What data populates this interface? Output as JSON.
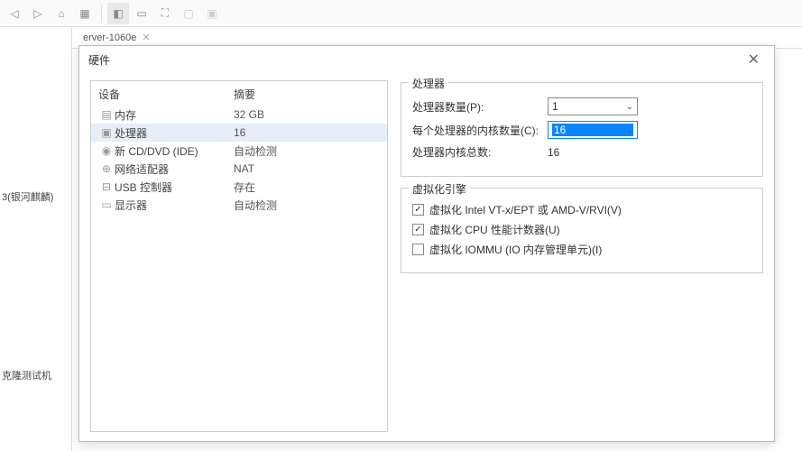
{
  "toolbar": {
    "icons": [
      "back",
      "fwd",
      "home",
      "grid",
      "layout1",
      "layout2",
      "layout3",
      "fit",
      "present"
    ]
  },
  "leftTab": "erver-1060e",
  "sidebarLabels": {
    "l1": "3(银河麒麟)",
    "l2": "克隆测试机"
  },
  "dialog": {
    "title": "硬件"
  },
  "deviceTable": {
    "headers": {
      "device": "设备",
      "summary": "摘要"
    },
    "rows": [
      {
        "icon": "memory",
        "name": "内存",
        "summary": "32 GB",
        "selected": false
      },
      {
        "icon": "cpu",
        "name": "处理器",
        "summary": "16",
        "selected": true
      },
      {
        "icon": "disc",
        "name": "新 CD/DVD (IDE)",
        "summary": "自动检测",
        "selected": false
      },
      {
        "icon": "net",
        "name": "网络适配器",
        "summary": "NAT",
        "selected": false
      },
      {
        "icon": "usb",
        "name": "USB 控制器",
        "summary": "存在",
        "selected": false
      },
      {
        "icon": "display",
        "name": "显示器",
        "summary": "自动检测",
        "selected": false
      }
    ]
  },
  "processorPanel": {
    "legend": "处理器",
    "fields": {
      "count": {
        "label": "处理器数量(P):",
        "value": "1"
      },
      "cores": {
        "label": "每个处理器的内核数量(C):",
        "value": "16"
      },
      "total": {
        "label": "处理器内核总数:",
        "value": "16"
      }
    }
  },
  "virtPanel": {
    "legend": "虚拟化引擎",
    "options": [
      {
        "checked": true,
        "label": "虚拟化 Intel VT-x/EPT 或 AMD-V/RVI(V)"
      },
      {
        "checked": true,
        "label": "虚拟化 CPU 性能计数器(U)"
      },
      {
        "checked": false,
        "label": "虚拟化 IOMMU (IO 内存管理单元)(I)"
      }
    ]
  }
}
